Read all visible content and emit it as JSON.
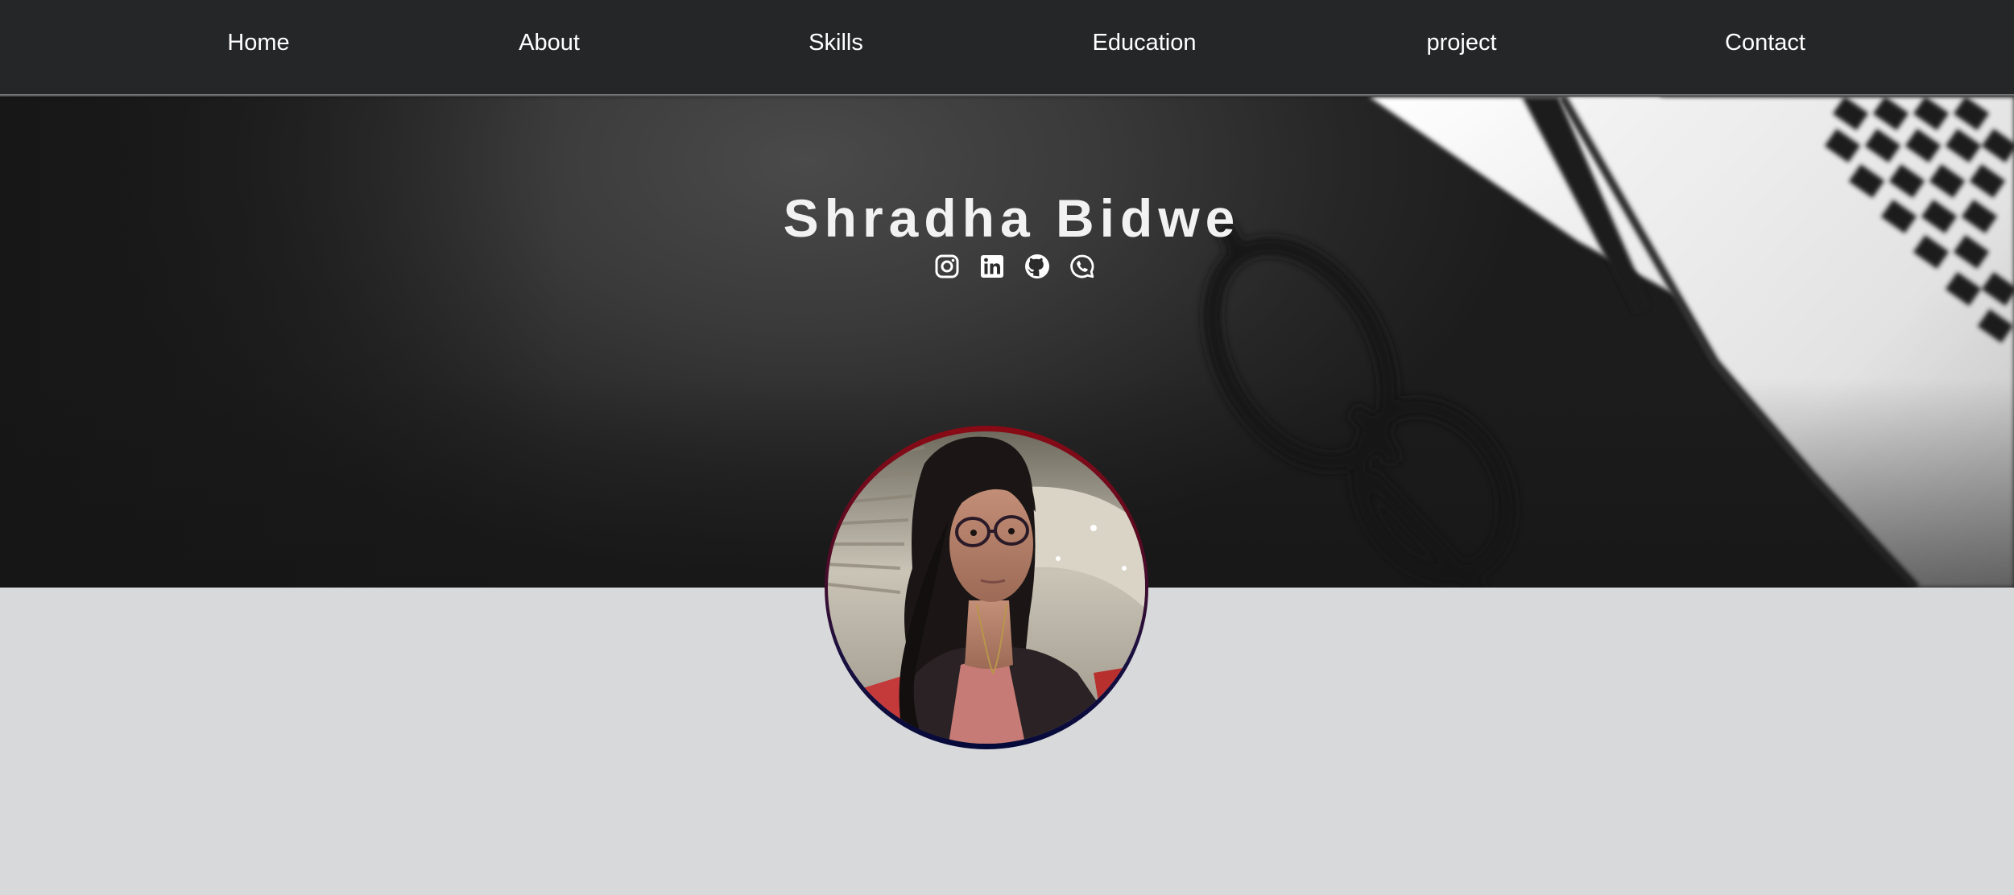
{
  "nav": {
    "items": [
      {
        "label": "Home"
      },
      {
        "label": "About"
      },
      {
        "label": "Skills"
      },
      {
        "label": "Education"
      },
      {
        "label": "project"
      },
      {
        "label": "Contact"
      }
    ]
  },
  "hero": {
    "name": "Shradha Bidwe",
    "social_icons": [
      "instagram-icon",
      "linkedin-icon",
      "github-icon",
      "whatsapp-icon"
    ]
  },
  "colors": {
    "navbar": "#252628",
    "page_background": "#d8d9db",
    "hero_text": "#f2f2f2",
    "profile_ring_top": "#8a0a14",
    "profile_ring_bottom": "#050a3a"
  }
}
